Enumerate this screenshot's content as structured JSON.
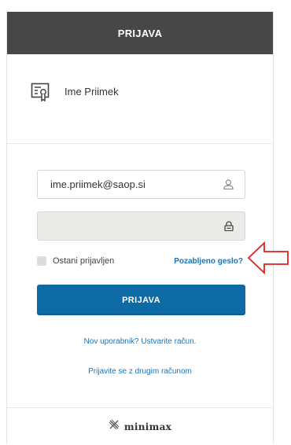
{
  "header": {
    "title": "PRIJAVA"
  },
  "user": {
    "name": "Ime Priimek",
    "icon": "certificate-icon"
  },
  "form": {
    "email_value": "ime.priimek@saop.si",
    "email_icon": "user-icon",
    "password_value": "",
    "password_icon": "lock-icon",
    "remember_label": "Ostani prijavljen",
    "forgot_label": "Pozabljeno geslo?",
    "login_label": "PRIJAVA"
  },
  "links": {
    "register": "Nov uporabnik? Ustvarite račun.",
    "other_account": "Prijavite se z drugim računom"
  },
  "footer": {
    "brand": "minimax",
    "logo_icon": "minimax-logo-icon"
  },
  "annotation": {
    "arrow_color": "#e02020"
  },
  "colors": {
    "header_bg": "#474747",
    "primary_button": "#0e6aa5",
    "link": "#1a74b5",
    "password_bg": "#ebebe7"
  }
}
